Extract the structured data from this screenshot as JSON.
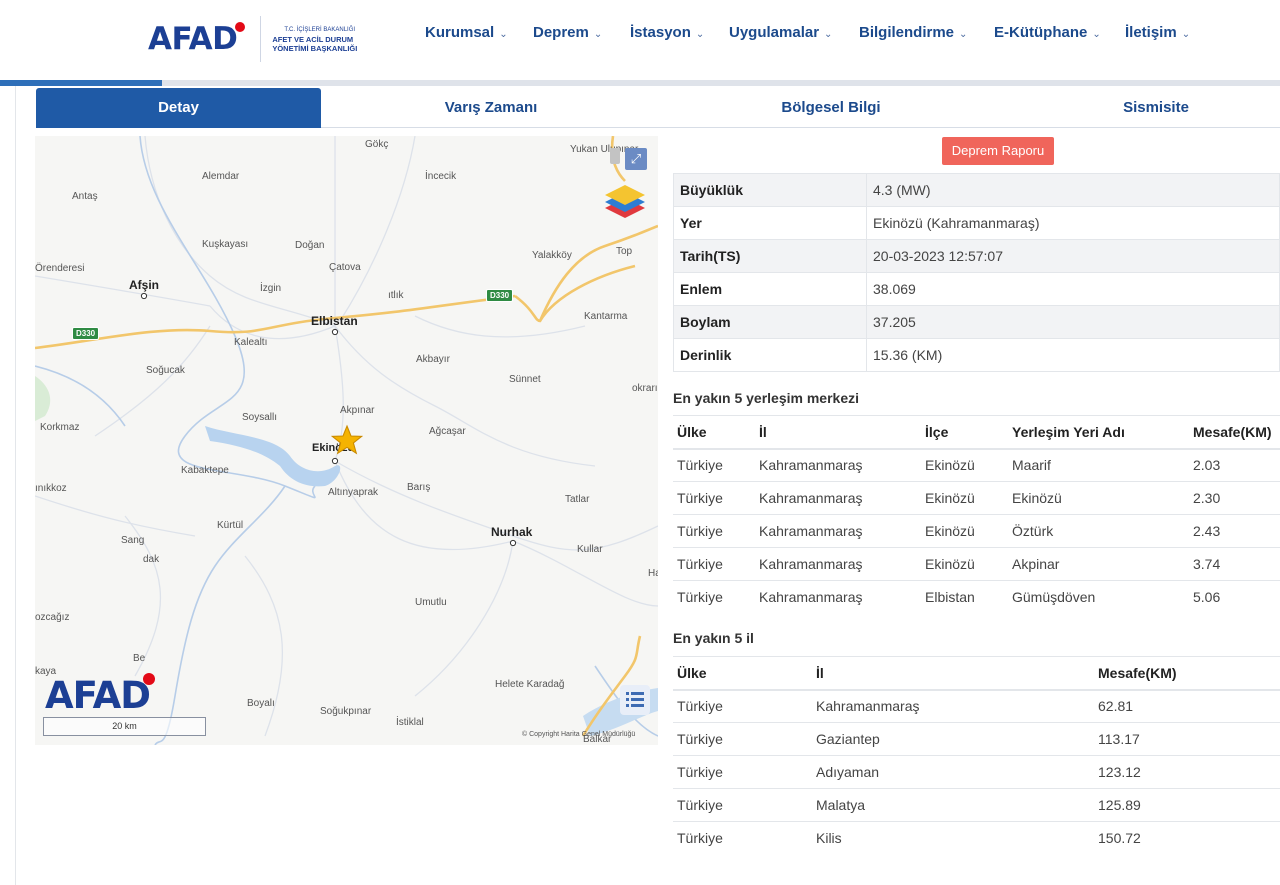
{
  "header": {
    "logo_text": "AFAD",
    "logo_sub": [
      "T.C. İÇİŞLERİ BAKANLIĞI",
      "AFET VE ACİL DURUM",
      "YÖNETİMİ BAŞKANLIĞI"
    ],
    "nav": [
      "Kurumsal",
      "Deprem",
      "İstasyon",
      "Uygulamalar",
      "Bilgilendirme",
      "E-Kütüphane",
      "İletişim"
    ]
  },
  "tabs": [
    "Detay",
    "Varış Zamanı",
    "Bölgesel Bilgi",
    "Sismisite"
  ],
  "map": {
    "places": [
      "Gökç",
      "İncecik",
      "Yukan Ulupınar",
      "Alemdar",
      "Antaş",
      "Kuşkayası",
      "Doğan",
      "Yalakköy",
      "Top",
      "Örenderesi",
      "Çatova",
      "Afşin",
      "İzgin",
      "ıtlık",
      "Elbistan",
      "Kantarma",
      "Kalealtı",
      "Akbayır",
      "Soğucak",
      "Sünnet",
      "okrarı",
      "Soysallı",
      "Akpınar",
      "Korkmaz",
      "Ağcaşar",
      "Ekinözü",
      "Kabaktepe",
      "Barış",
      "Altınyaprak",
      "Tatlar",
      "ınıkkoz",
      "Kürtül",
      "Nurhak",
      "Sang",
      "dak",
      "Kullar",
      "Ha",
      "Umutlu",
      "ozcağız",
      "Be",
      "kaya",
      "Helete Karadağ",
      "Boyalı",
      "Soğukpınar",
      "İstiklal",
      "Balkar"
    ],
    "roads": [
      "D330",
      "D330"
    ],
    "logo": "AFAD",
    "scale": "20 km",
    "copyright": "© Copyright Harita Genel Müdürlüğü"
  },
  "report_button": "Deprem Raporu",
  "details": [
    {
      "key": "Büyüklük",
      "value": "4.3 (MW)"
    },
    {
      "key": "Yer",
      "value": "Ekinözü (Kahramanmaraş)"
    },
    {
      "key": "Tarih(TS)",
      "value": "20-03-2023 12:57:07"
    },
    {
      "key": "Enlem",
      "value": "38.069"
    },
    {
      "key": "Boylam",
      "value": "37.205"
    },
    {
      "key": "Derinlik",
      "value": "15.36 (KM)"
    }
  ],
  "nearest_settlements": {
    "title": "En yakın 5 yerleşim merkezi",
    "headers": [
      "Ülke",
      "İl",
      "İlçe",
      "Yerleşim Yeri Adı",
      "Mesafe(KM)"
    ],
    "rows": [
      [
        "Türkiye",
        "Kahramanmaraş",
        "Ekinözü",
        "Maarif",
        "2.03"
      ],
      [
        "Türkiye",
        "Kahramanmaraş",
        "Ekinözü",
        "Ekinözü",
        "2.30"
      ],
      [
        "Türkiye",
        "Kahramanmaraş",
        "Ekinözü",
        "Öztürk",
        "2.43"
      ],
      [
        "Türkiye",
        "Kahramanmaraş",
        "Ekinözü",
        "Akpinar",
        "3.74"
      ],
      [
        "Türkiye",
        "Kahramanmaraş",
        "Elbistan",
        "Gümüşdöven",
        "5.06"
      ]
    ]
  },
  "nearest_provinces": {
    "title": "En yakın 5 il",
    "headers": [
      "Ülke",
      "İl",
      "Mesafe(KM)"
    ],
    "rows": [
      [
        "Türkiye",
        "Kahramanmaraş",
        "62.81"
      ],
      [
        "Türkiye",
        "Gaziantep",
        "113.17"
      ],
      [
        "Türkiye",
        "Adıyaman",
        "123.12"
      ],
      [
        "Türkiye",
        "Malatya",
        "125.89"
      ],
      [
        "Türkiye",
        "Kilis",
        "150.72"
      ]
    ]
  }
}
